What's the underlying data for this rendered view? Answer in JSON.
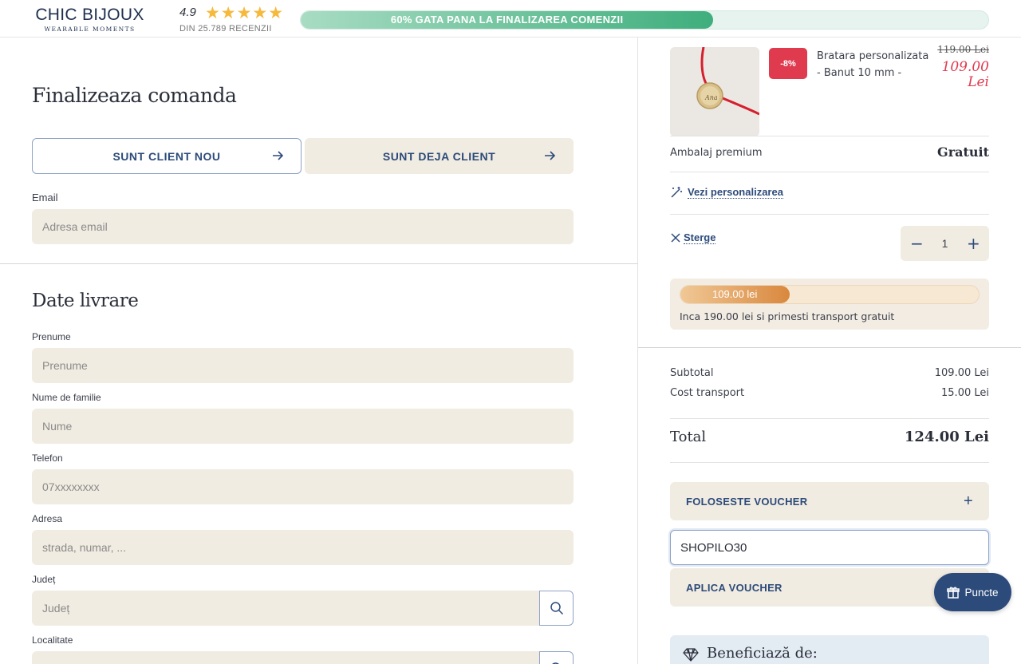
{
  "brand": {
    "name": "CHIC BIJOUX",
    "tagline": "WEARABLE MOMENTS"
  },
  "rating": {
    "score": "4.9",
    "stars": "★★★★★",
    "reviews": "DIN 25.789 RECENZII"
  },
  "top_progress": {
    "text": "60% GATA PANA LA FINALIZAREA COMENZII",
    "fraction": 0.6
  },
  "checkout": {
    "title": "Finalizeaza comanda",
    "new_client": "SUNT CLIENT NOU",
    "existing_client": "SUNT DEJA CLIENT",
    "email_label": "Email",
    "email_placeholder": "Adresa email"
  },
  "delivery": {
    "title": "Date livrare",
    "first_name_label": "Prenume",
    "first_name_placeholder": "Prenume",
    "last_name_label": "Nume de familie",
    "last_name_placeholder": "Nume",
    "phone_label": "Telefon",
    "phone_placeholder": "07xxxxxxxx",
    "address_label": "Adresa",
    "address_placeholder": "strada, numar, ...",
    "county_label": "Județ",
    "county_placeholder": "Județ",
    "city_label": "Localitate",
    "city_placeholder": ""
  },
  "cart": {
    "product": {
      "discount": "-8%",
      "name": "Bratara personalizata",
      "variant": "- Banut 10 mm -",
      "old_price": "119.00 Lei",
      "new_price": "109.00 Lei",
      "image_text": "Ana"
    },
    "packaging_label": "Ambalaj premium",
    "packaging_value": "Gratuit",
    "view_personalization": "Vezi personalizarea",
    "remove": "Sterge",
    "quantity": "1",
    "shipping_progress": {
      "amount": "109.00 lei",
      "fraction": 0.365,
      "message": "Inca 190.00 lei si primesti transport gratuit"
    }
  },
  "summary": {
    "subtotal_label": "Subtotal",
    "subtotal_value": "109.00 Lei",
    "shipping_label": "Cost transport",
    "shipping_value": "15.00 Lei",
    "total_label": "Total",
    "total_value": "124.00 Lei"
  },
  "voucher": {
    "toggle_label": "FOLOSESTE VOUCHER",
    "toggle_icon": "+",
    "code": "SHOPILO30",
    "apply_label": "APLICA VOUCHER"
  },
  "benefits": {
    "title": "Beneficiază de:"
  },
  "points_button": {
    "label": "Puncte"
  },
  "colors": {
    "accent": "#2c4a7a",
    "field_bg": "#f1ece1",
    "sale": "#e03a4f",
    "green": "#3fae7d",
    "orange": "#d9883e"
  }
}
